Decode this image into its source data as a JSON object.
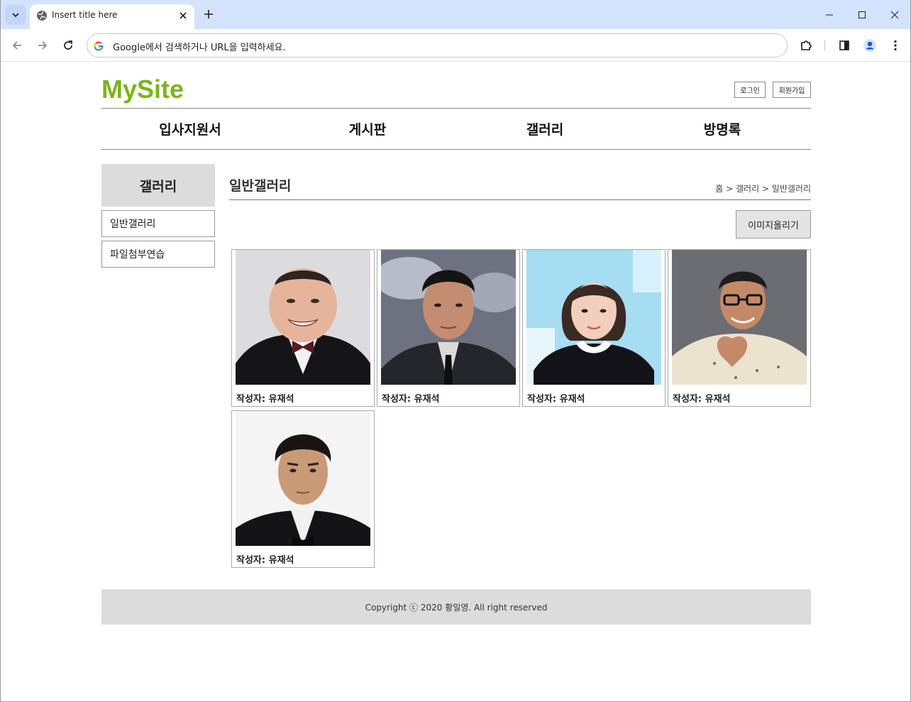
{
  "browser": {
    "tab_title": "Insert title here",
    "omnibox_placeholder": "Google에서 검색하거나 URL을 입력하세요."
  },
  "site": {
    "logo": "MySite",
    "login_label": "로그인",
    "signup_label": "회원가입",
    "nav": [
      "입사지원서",
      "게시판",
      "갤러리",
      "방명록"
    ]
  },
  "sidebar": {
    "title": "갤러리",
    "items": [
      "일반갤러리",
      "파일첨부연습"
    ]
  },
  "content": {
    "title": "일반갤러리",
    "breadcrumb": "홈  >  갤러리  >  일반갤러리",
    "upload_label": "이미지올리기",
    "cards": [
      {
        "writer": "작성자: 유재석"
      },
      {
        "writer": "작성자: 유재석"
      },
      {
        "writer": "작성자: 유재석"
      },
      {
        "writer": "작성자: 유재석"
      },
      {
        "writer": "작성자: 유재석"
      }
    ]
  },
  "footer": {
    "copyright": "Copyright ⓒ 2020 황일영. All right reserved"
  },
  "colors": {
    "brand": "#7cb518",
    "tabstrip": "#d3e3fd",
    "panel_gray": "#dcdcdc"
  }
}
